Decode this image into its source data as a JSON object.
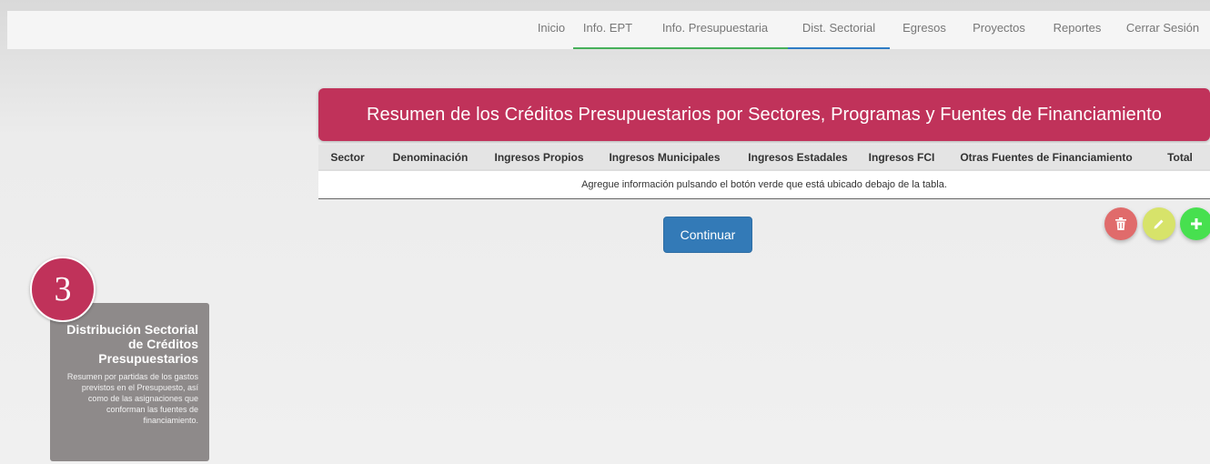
{
  "nav": {
    "items": [
      {
        "label": "Inicio"
      },
      {
        "label": "Info. EPT"
      },
      {
        "label": "Info. Presupuestaria"
      },
      {
        "label": "Dist. Sectorial"
      },
      {
        "label": "Egresos"
      },
      {
        "label": "Proyectos"
      },
      {
        "label": "Reportes"
      },
      {
        "label": "Cerrar Sesión"
      }
    ]
  },
  "main": {
    "title": "Resumen de los Créditos Presupuestarios por Sectores, Programas y Fuentes de Financiamiento",
    "table": {
      "headers": [
        "Sector",
        "Denominación",
        "Ingresos Propios",
        "Ingresos Municipales",
        "Ingresos Estadales",
        "Ingresos FCI",
        "Otras Fuentes de Financiamiento",
        "Total"
      ],
      "empty_message": "Agregue información pulsando el botón verde que está ubicado debajo de la tabla."
    },
    "continue_label": "Continuar",
    "actions": [
      {
        "icon": "trash-icon",
        "color": "#e06b6b"
      },
      {
        "icon": "pencil-icon",
        "color": "#d7e36a"
      },
      {
        "icon": "plus-icon",
        "color": "#47e04f"
      }
    ]
  },
  "step": {
    "number": "3",
    "title": "Distribución Sectorial de Créditos Presupuestarios",
    "description": "Resumen por partidas de los gastos previstos en el Presupuesto, así como de las asignaciones que conforman las fuentes de financiamiento."
  },
  "colors": {
    "accent": "#c0325a",
    "primary_button": "#337ab7"
  }
}
